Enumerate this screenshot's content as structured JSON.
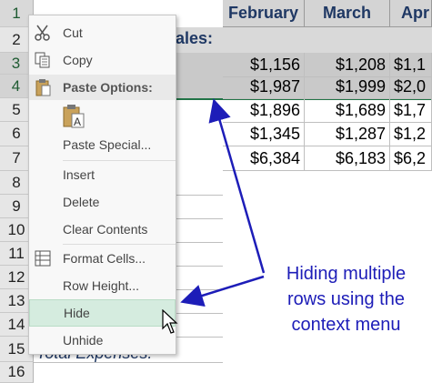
{
  "columns": [
    "February",
    "March",
    "Apr"
  ],
  "rows": [
    {
      "num": "1",
      "cells": [
        "February",
        "March",
        "Apr"
      ]
    },
    {
      "num": "2",
      "cells": [
        "",
        "",
        ""
      ]
    },
    {
      "num": "3",
      "cells": [
        "$1,156",
        "$1,208",
        "$1,1"
      ]
    },
    {
      "num": "4",
      "cells": [
        "$1,987",
        "$1,999",
        "$2,0"
      ]
    },
    {
      "num": "5",
      "cells": [
        "$1,896",
        "$1,689",
        "$1,7"
      ]
    },
    {
      "num": "6",
      "cells": [
        "$1,345",
        "$1,287",
        "$1,2"
      ]
    },
    {
      "num": "7",
      "cells": [
        "$6,384",
        "$6,183",
        "$6,2"
      ]
    },
    {
      "num": "8"
    },
    {
      "num": "9"
    },
    {
      "num": "10"
    },
    {
      "num": "11"
    },
    {
      "num": "12"
    },
    {
      "num": "13"
    },
    {
      "num": "14"
    },
    {
      "num": "15"
    },
    {
      "num": "16"
    }
  ],
  "a2_partial": "ales:",
  "a15_partial": "Total Expenses:",
  "menu": {
    "cut": "Cut",
    "copy": "Copy",
    "paste_options": "Paste Options:",
    "paste_special": "Paste Special...",
    "insert": "Insert",
    "delete": "Delete",
    "clear_contents": "Clear Contents",
    "format_cells": "Format Cells...",
    "row_height": "Row Height...",
    "hide": "Hide",
    "unhide": "Unhide"
  },
  "annotation": {
    "line1": "Hiding multiple",
    "line2": "rows using the",
    "line3": "context menu"
  },
  "colors": {
    "annotation": "#1d1db8",
    "arrow": "#1d1db8",
    "hover": "#d5ecdf",
    "selection_band": "#d9d9d9"
  }
}
